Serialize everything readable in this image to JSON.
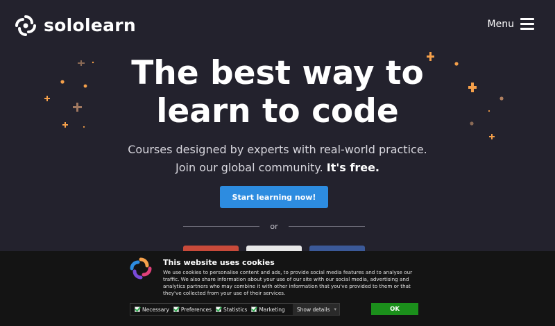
{
  "header": {
    "logo_text": "sololearn",
    "menu_label": "Menu"
  },
  "hero": {
    "title_line1": "The best way to",
    "title_line2": "learn to code",
    "subtitle_line1": "Courses designed by experts with real-world practice.",
    "subtitle_line2": "Join our global community.",
    "subtitle_free": "It's free.",
    "cta_label": "Start learning now!",
    "or_label": "or"
  },
  "social_buttons": [
    {
      "name": "google",
      "color": "#c84a3a"
    },
    {
      "name": "apple",
      "color": "#e8e8e8"
    },
    {
      "name": "facebook",
      "color": "#3b5998"
    }
  ],
  "cookie_banner": {
    "title": "This website uses cookies",
    "body": "We use cookies to personalise content and ads, to provide social media features and to analyse our traffic. We also share information about your use of our site with our social media, advertising and analytics partners who may combine it with other information that you've provided to them or that they've collected from your use of their services.",
    "options": [
      "Necessary",
      "Preferences",
      "Statistics",
      "Marketing"
    ],
    "show_details_label": "Show details",
    "ok_label": "OK"
  },
  "colors": {
    "background": "#23222d",
    "accent_blue": "#2d8ce0",
    "star_orange": "#f5a04a",
    "ok_green": "#1b8f1b"
  }
}
